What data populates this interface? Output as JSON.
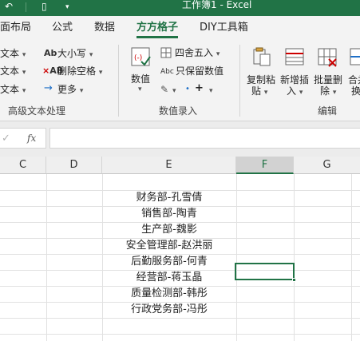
{
  "window": {
    "title": "工作簿1  -  Excel"
  },
  "tabs": [
    {
      "label": "页面布局"
    },
    {
      "label": "公式"
    },
    {
      "label": "数据"
    },
    {
      "label": "方方格子"
    },
    {
      "label": "DIY工具箱"
    }
  ],
  "ribbon": {
    "text_group": {
      "left_items": [
        "文本",
        "文本",
        "文本"
      ],
      "case_label": "大小写",
      "remove_spaces_label": "删除空格",
      "more_label": "更多",
      "group_label": "高级文本处理"
    },
    "number_group": {
      "number_label": "数值",
      "round_label": "四舍五入",
      "keep_number_label": "只保留数值",
      "group_label": "数值录入"
    },
    "edit_group": {
      "copy_paste_label": [
        "复制粘",
        "贴"
      ],
      "insert_label": [
        "新增插",
        "入"
      ],
      "batch_delete_label": [
        "批量删",
        "除"
      ],
      "merge_label": [
        "合并",
        "换"
      ],
      "group_label": "编辑"
    }
  },
  "formula_bar": {
    "fx": "fx",
    "value": ""
  },
  "sheet": {
    "columns": [
      "C",
      "D",
      "E",
      "F",
      "G"
    ],
    "selected_column": "F",
    "column_e_values": [
      "财务部-孔雪倩",
      "销售部-陶青",
      "生产部-魏影",
      "安全管理部-赵洪丽",
      "后勤服务部-何青",
      "经营部-蒋玉晶",
      "质量检测部-韩彤",
      "行政党务部-冯彤"
    ]
  },
  "colors": {
    "accent": "#217346",
    "ribbon_bg": "#f3f3f3",
    "grid_line": "#e1e1e1"
  }
}
